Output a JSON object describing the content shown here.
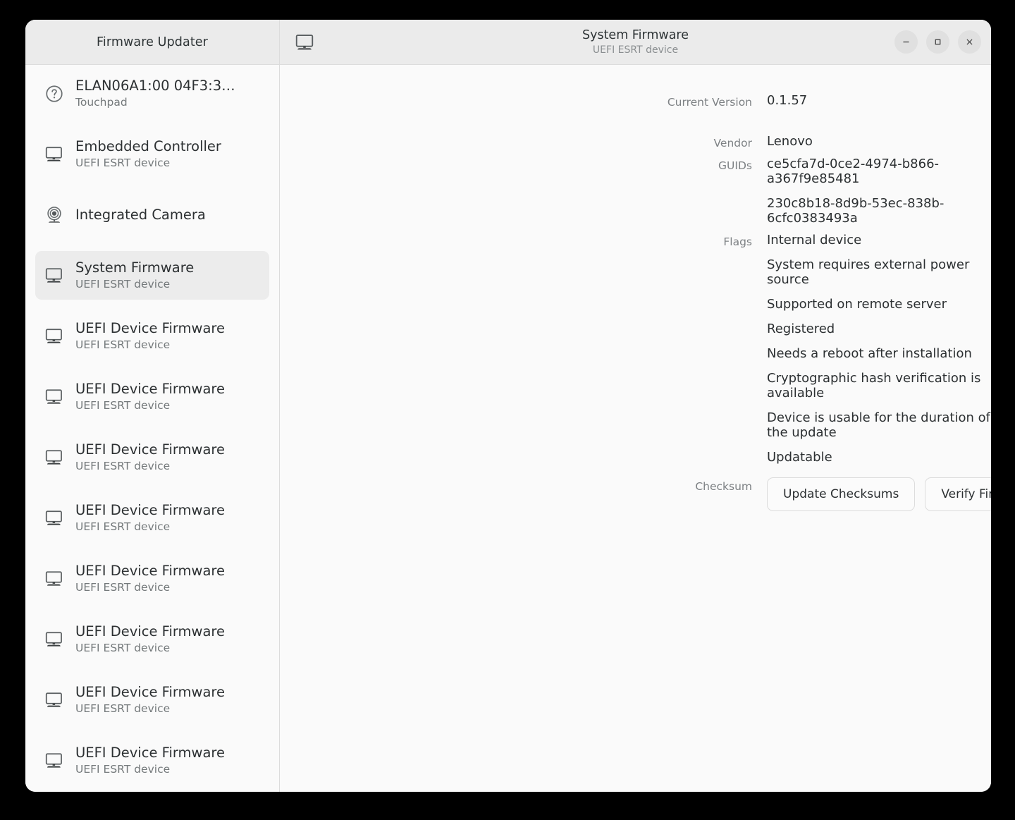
{
  "window": {
    "app_title": "Firmware Updater",
    "header": {
      "device_icon": "monitor-icon",
      "title": "System Firmware",
      "subtitle": "UEFI ESRT device"
    },
    "controls": {
      "minimize": "–",
      "maximize": "□",
      "close": "✕"
    }
  },
  "sidebar": {
    "items": [
      {
        "icon": "help-circle-icon",
        "name": "ELAN06A1:00 04F3:3…",
        "sub": "Touchpad",
        "selected": false
      },
      {
        "icon": "monitor-icon",
        "name": "Embedded Controller",
        "sub": "UEFI ESRT device",
        "selected": false
      },
      {
        "icon": "camera-icon",
        "name": "Integrated Camera",
        "sub": "",
        "selected": false
      },
      {
        "icon": "monitor-icon",
        "name": "System Firmware",
        "sub": "UEFI ESRT device",
        "selected": true
      },
      {
        "icon": "monitor-icon",
        "name": "UEFI Device Firmware",
        "sub": "UEFI ESRT device",
        "selected": false
      },
      {
        "icon": "monitor-icon",
        "name": "UEFI Device Firmware",
        "sub": "UEFI ESRT device",
        "selected": false
      },
      {
        "icon": "monitor-icon",
        "name": "UEFI Device Firmware",
        "sub": "UEFI ESRT device",
        "selected": false
      },
      {
        "icon": "monitor-icon",
        "name": "UEFI Device Firmware",
        "sub": "UEFI ESRT device",
        "selected": false
      },
      {
        "icon": "monitor-icon",
        "name": "UEFI Device Firmware",
        "sub": "UEFI ESRT device",
        "selected": false
      },
      {
        "icon": "monitor-icon",
        "name": "UEFI Device Firmware",
        "sub": "UEFI ESRT device",
        "selected": false
      },
      {
        "icon": "monitor-icon",
        "name": "UEFI Device Firmware",
        "sub": "UEFI ESRT device",
        "selected": false
      },
      {
        "icon": "monitor-icon",
        "name": "UEFI Device Firmware",
        "sub": "UEFI ESRT device",
        "selected": false
      }
    ]
  },
  "detail": {
    "version": {
      "label": "Current Version",
      "value": "0.1.57"
    },
    "vendor": {
      "label": "Vendor",
      "value": "Lenovo"
    },
    "guids": {
      "label": "GUIDs",
      "values": [
        "ce5cfa7d-0ce2-4974-b866-a367f9e85481",
        "230c8b18-8d9b-53ec-838b-6cfc0383493a"
      ]
    },
    "flags": {
      "label": "Flags",
      "values": [
        "Internal device",
        "System requires external power source",
        "Supported on remote server",
        "Registered",
        "Needs a reboot after installation",
        "Cryptographic hash verification is available",
        "Device is usable for the duration of the update",
        "Updatable"
      ]
    },
    "checksum": {
      "label": "Checksum",
      "update_button": "Update Checksums",
      "verify_button": "Verify Firmware"
    }
  },
  "colors": {
    "window_bg": "#fafafa",
    "headerbar_bg": "#ebebeb",
    "selected_row_bg": "#ececec",
    "text_primary": "#2c3032",
    "text_secondary": "#7d8184",
    "border": "#dcdcdc"
  }
}
